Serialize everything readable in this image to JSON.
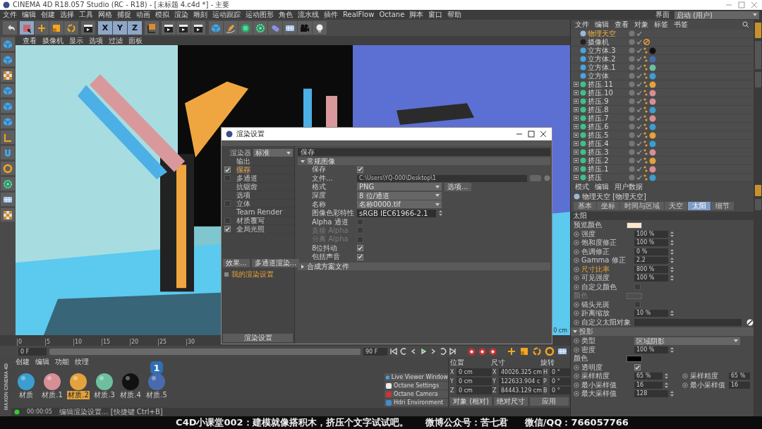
{
  "window": {
    "title": "CINEMA 4D R18.057 Studio (RC - R18) - [未标题 4.c4d *] - 主要"
  },
  "menu": [
    "文件",
    "编辑",
    "创建",
    "选择",
    "工具",
    "网格",
    "捕捉",
    "动画",
    "模拟",
    "渲染",
    "雕刻",
    "运动跟踪",
    "运动图形",
    "角色",
    "流水线",
    "插件",
    "RealFlow",
    "Octane",
    "脚本",
    "窗口",
    "帮助"
  ],
  "layout": {
    "label": "界面",
    "value": "启动 (用户)"
  },
  "toolbar": {
    "axes": [
      "X",
      "Y",
      "Z"
    ]
  },
  "viewport": {
    "menu": [
      "查看",
      "摄像机",
      "显示",
      "选项",
      "过滤",
      "面板"
    ],
    "scale_label": "0 cm"
  },
  "render_settings": {
    "title": "渲染设置",
    "renderer_label": "渲染器",
    "renderer": "标准",
    "items": [
      {
        "label": "输出",
        "kind": "plain",
        "selected": false
      },
      {
        "label": "保存",
        "kind": "toggle",
        "checked": true,
        "selected": true
      },
      {
        "label": "多通道",
        "kind": "toggle",
        "checked": false,
        "selected": false
      },
      {
        "label": "抗锯齿",
        "kind": "plain",
        "selected": false
      },
      {
        "label": "选项",
        "kind": "plain",
        "selected": false
      },
      {
        "label": "立体",
        "kind": "toggle",
        "checked": false,
        "selected": false
      },
      {
        "label": "Team Render",
        "kind": "plain",
        "selected": false
      },
      {
        "label": "材质覆写",
        "kind": "toggle",
        "checked": false,
        "selected": false
      },
      {
        "label": "全局光照",
        "kind": "toggle",
        "checked": true,
        "selected": false
      }
    ],
    "buttons": [
      "效果...",
      "多通道渲染..."
    ],
    "preset": "我的渲染设置",
    "footer_button": "渲染设置",
    "panel_title": "保存",
    "sections": [
      {
        "title": "常规图像",
        "expanded": true,
        "rows": [
          {
            "kind": "checkbox",
            "label": "保存",
            "checked": true,
            "disabled": false
          },
          {
            "kind": "path",
            "label": "文件...",
            "value": "C:\\Users\\YQ-000\\Desktop\\1"
          },
          {
            "kind": "dropdown",
            "label": "格式",
            "value": "PNG",
            "button": "选项..."
          },
          {
            "kind": "dropdown",
            "label": "深度",
            "value": "8 位/通道"
          },
          {
            "kind": "dropdown",
            "label": "名称",
            "value": "名称0000.tif"
          },
          {
            "kind": "profile",
            "label": "图像色彩特性",
            "value": "sRGB IEC61966-2.1"
          },
          {
            "kind": "checkbox",
            "label": "Alpha 通道",
            "checked": false,
            "disabled": false
          },
          {
            "kind": "checkbox",
            "label": "直接 Alpha",
            "checked": false,
            "disabled": true
          },
          {
            "kind": "checkbox",
            "label": "分离 Alpha",
            "checked": false,
            "disabled": true
          },
          {
            "kind": "checkbox",
            "label": "8位抖动",
            "checked": true,
            "disabled": false
          },
          {
            "kind": "checkbox",
            "label": "包括声音",
            "checked": true,
            "disabled": false
          }
        ]
      },
      {
        "title": "合成方案文件",
        "expanded": false
      }
    ]
  },
  "timeline": {
    "ticks": [
      "0",
      "5",
      "10",
      "15",
      "20",
      "25",
      "30"
    ],
    "start": "0 F",
    "end": "90 F"
  },
  "materials": {
    "menu": [
      "创建",
      "编辑",
      "功能",
      "纹理"
    ],
    "badge": "1",
    "items": [
      {
        "name": "材质",
        "color": "#3a9fd0",
        "selected": false
      },
      {
        "name": "材质.1",
        "color": "#d58f95",
        "selected": false
      },
      {
        "name": "材质.2",
        "color": "#e3a23c",
        "selected": true
      },
      {
        "name": "材质.3",
        "color": "#6dbfa0",
        "selected": false
      },
      {
        "name": "材质.4",
        "color": "#111111",
        "selected": false
      },
      {
        "name": "材质.5",
        "color": "#4a6ab0",
        "selected": false
      }
    ]
  },
  "logo": "MAXON CINEMA 4D",
  "octane_menu": [
    {
      "label": "Live Viewer Window",
      "kind": "viewer"
    },
    {
      "label": "Octane Settings",
      "kind": "settings"
    },
    {
      "label": "Octane Camera",
      "kind": "camera"
    },
    {
      "label": "Hdri Environment",
      "kind": "environment"
    }
  ],
  "coordinates": {
    "headers": [
      "位置",
      "尺寸",
      "旋转"
    ],
    "rows": [
      {
        "axis": "X",
        "position": "0 cm",
        "size_axis": "X",
        "size": "40026.325 cm",
        "rot_axis": "H",
        "rotation": "0 °"
      },
      {
        "axis": "Y",
        "position": "0 cm",
        "size_axis": "Y",
        "size": "122633.904 c",
        "rot_axis": "P",
        "rotation": "0 °"
      },
      {
        "axis": "Z",
        "position": "0 cm",
        "size_axis": "Z",
        "size": "84443.129 cm",
        "rot_axis": "B",
        "rotation": "0 °"
      }
    ],
    "mode": "对象 (相对)",
    "size_mode": "绝对尺寸",
    "apply": "应用"
  },
  "status_bar": {
    "time": "00:00:05",
    "message": "编辑渲染设置... [快捷键 Ctrl+B]"
  },
  "objects": {
    "menu": [
      "文件",
      "编辑",
      "查看",
      "对象",
      "标签",
      "书签"
    ],
    "items": [
      {
        "name": "物理天空",
        "kind": "sky",
        "selected": true
      },
      {
        "name": "摄像机",
        "kind": "camera",
        "selected": false
      },
      {
        "name": "立方体.3",
        "kind": "cube",
        "selected": false,
        "color": "#111111"
      },
      {
        "name": "立方体.2",
        "kind": "cube",
        "selected": false,
        "color": "#4a6ab0"
      },
      {
        "name": "立方体.1",
        "kind": "cube",
        "selected": false,
        "color": "#6dbfa0"
      },
      {
        "name": "立方体",
        "kind": "cube",
        "selected": false,
        "color": "#3a9fd0"
      },
      {
        "name": "挤压.11",
        "kind": "extrude",
        "selected": false,
        "color": "#e3a23c"
      },
      {
        "name": "挤压.10",
        "kind": "extrude",
        "selected": false,
        "color": "#d58f95"
      },
      {
        "name": "挤压.9",
        "kind": "extrude",
        "selected": false,
        "color": "#d58f95"
      },
      {
        "name": "挤压.8",
        "kind": "extrude",
        "selected": false,
        "color": "#3a9fd0"
      },
      {
        "name": "挤压.7",
        "kind": "extrude",
        "selected": false,
        "color": "#d58f95"
      },
      {
        "name": "挤压.6",
        "kind": "extrude",
        "selected": false,
        "color": "#3a9fd0"
      },
      {
        "name": "挤压.5",
        "kind": "extrude",
        "selected": false,
        "color": "#e3a23c"
      },
      {
        "name": "挤压.4",
        "kind": "extrude",
        "selected": false,
        "color": "#3a9fd0"
      },
      {
        "name": "挤压.3",
        "kind": "extrude",
        "selected": false,
        "color": "#d58f95"
      },
      {
        "name": "挤压.2",
        "kind": "extrude",
        "selected": false,
        "color": "#e3a23c"
      },
      {
        "name": "挤压.1",
        "kind": "extrude",
        "selected": false,
        "color": "#d58f95"
      },
      {
        "name": "挤压",
        "kind": "extrude",
        "selected": false,
        "color": "#3a9fd0"
      }
    ]
  },
  "attributes": {
    "menu": [
      "模式",
      "编辑",
      "用户数据"
    ],
    "title": "物理天空 [物理天空]",
    "tabs": [
      {
        "label": "基本",
        "selected": false
      },
      {
        "label": "坐标",
        "selected": false
      },
      {
        "label": "时间与区域",
        "selected": false
      },
      {
        "label": "天空",
        "selected": false
      },
      {
        "label": "太阳",
        "selected": true
      },
      {
        "label": "细节",
        "selected": false
      }
    ],
    "sections": [
      {
        "title": "太阳",
        "kind": "header",
        "rows": [
          {
            "kind": "swatch",
            "label": "预览颜色",
            "color": "#fbe6cf",
            "keyed": false,
            "disabled": false
          },
          {
            "kind": "number",
            "label": "强度",
            "value": "100 %",
            "keyed": false,
            "disabled": false
          },
          {
            "kind": "number",
            "label": "饱和度修正",
            "value": "100 %",
            "keyed": false,
            "disabled": false
          },
          {
            "kind": "number",
            "label": "色调修正",
            "value": "0 %",
            "keyed": false,
            "disabled": false
          },
          {
            "kind": "number",
            "label": "Gamma 修正",
            "value": "2.2",
            "keyed": false,
            "disabled": false
          },
          {
            "kind": "number",
            "label": "尺寸比率",
            "value": "800 %",
            "keyed": true,
            "disabled": false
          },
          {
            "kind": "number",
            "label": "可见强度",
            "value": "100 %",
            "keyed": false,
            "disabled": false
          },
          {
            "kind": "checkbox",
            "label": "自定义颜色",
            "checked": false,
            "keyed": false,
            "disabled": false
          },
          {
            "kind": "swatch",
            "label": "颜色",
            "color": "#4e4e4e",
            "keyed": false,
            "disabled": true
          },
          {
            "kind": "checkbox",
            "label": "镜头光斑",
            "checked": false,
            "keyed": false,
            "disabled": false
          },
          {
            "kind": "number",
            "label": "距离缩放",
            "value": "10 %",
            "keyed": false,
            "disabled": false
          },
          {
            "kind": "link",
            "label": "自定义太阳对象",
            "keyed": false,
            "disabled": false
          }
        ]
      },
      {
        "title": "投影",
        "kind": "group",
        "rows": [
          {
            "kind": "dropdown",
            "label": "类型",
            "value": "区域阴影",
            "keyed": false,
            "disabled": false
          },
          {
            "kind": "number",
            "label": "密度",
            "value": "100 %",
            "keyed": false,
            "disabled": false
          },
          {
            "kind": "swatch",
            "label": "颜色",
            "color": "#000000",
            "keyed": false,
            "disabled": false
          },
          {
            "kind": "checkbox",
            "label": "透明度",
            "checked": true,
            "keyed": false,
            "disabled": false
          },
          {
            "kind": "pair",
            "label": "采样精度",
            "value": "65 %",
            "label2": "采样精度",
            "value2": "65 %",
            "keyed": false,
            "disabled": false
          },
          {
            "kind": "pair",
            "label": "最小采样值",
            "value": "16",
            "label2": "最小采样值",
            "value2": "16",
            "keyed": false,
            "disabled": false
          },
          {
            "kind": "number",
            "label": "最大采样值",
            "value": "128",
            "keyed": false,
            "disabled": false
          }
        ]
      }
    ]
  },
  "side_tabs": {
    "objects": [
      {
        "selected": true
      },
      {
        "selected": false
      },
      {
        "selected": false
      }
    ],
    "attributes": [
      {
        "selected": true
      },
      {
        "selected": false
      }
    ]
  },
  "caption": [
    "C4D小课堂002：建模就像搭积木，挤压个文字试试吧。",
    "微博公众号：苦七君",
    "微信/QQ：766057766"
  ]
}
